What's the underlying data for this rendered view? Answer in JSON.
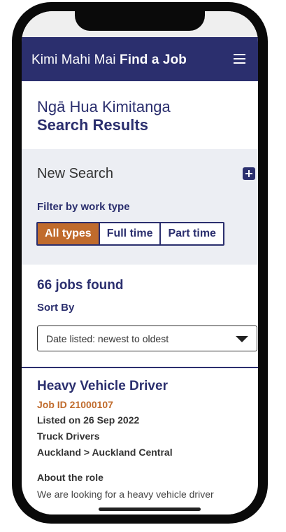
{
  "header": {
    "brand_maori": "Kimi Mahi Mai",
    "brand_en": "Find a Job",
    "menu_icon": "hamburger-icon"
  },
  "page": {
    "title_maori": "Ngā Hua Kimitanga",
    "title_en": "Search Results"
  },
  "search": {
    "new_search_label": "New Search",
    "expand_icon": "plus-square-icon",
    "filter_label": "Filter by work type",
    "filters": [
      {
        "label": "All types",
        "active": true
      },
      {
        "label": "Full time",
        "active": false
      },
      {
        "label": "Part time",
        "active": false
      }
    ]
  },
  "results": {
    "count_text": "66 jobs found",
    "sort_label": "Sort By",
    "sort_value": "Date listed: newest to oldest"
  },
  "job": {
    "title": "Heavy Vehicle Driver",
    "id_text": "Job ID 21000107",
    "listed": "Listed on 26 Sep 2022",
    "category": "Truck Drivers",
    "location": "Auckland > Auckland Central",
    "about_label": "About the role",
    "description": "We are looking for a heavy vehicle driver"
  },
  "colors": {
    "brand_navy": "#2b2f6e",
    "accent_orange": "#c06b2c",
    "panel_grey": "#eceef3"
  }
}
